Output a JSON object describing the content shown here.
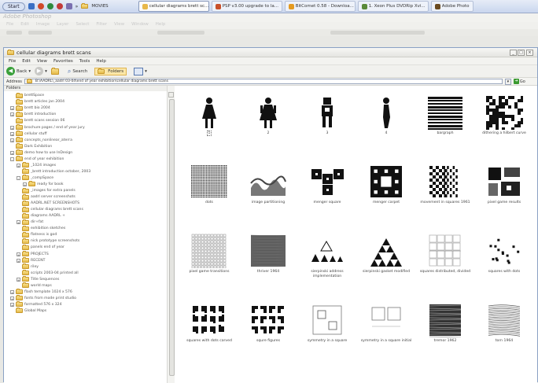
{
  "taskbar": {
    "start_label": "Start",
    "quick_label": "MOVIES",
    "buttons": [
      {
        "label": "cellular diagrams brett sc...",
        "icon": "folder-icon",
        "color": "#e8b84a",
        "active": true
      },
      {
        "label": "PSP v3.00 upgrade to la...",
        "icon": "browser-icon",
        "color": "#c8502a",
        "active": false
      },
      {
        "label": "BitComet 0.58 - Downloa...",
        "icon": "bitcomet-icon",
        "color": "#e49a20",
        "active": false
      },
      {
        "label": "1. Xeon Plus DVDRip Xvi...",
        "icon": "media-icon",
        "color": "#5a8a3a",
        "active": false
      },
      {
        "label": "Adobe Photo",
        "icon": "photoshop-icon",
        "color": "#6a4a20",
        "active": false
      }
    ]
  },
  "photoshop": {
    "title": "Adobe Photoshop",
    "menu": [
      "File",
      "Edit",
      "Image",
      "Layer",
      "Select",
      "Filter",
      "View",
      "Window",
      "Help"
    ]
  },
  "window": {
    "title": "cellular diagrams brett scans",
    "menu": [
      "File",
      "Edit",
      "View",
      "Favorites",
      "Tools",
      "Help"
    ],
    "toolbar": {
      "back": "Back",
      "search": "Search",
      "folders": "Folders"
    },
    "address_label": "Address",
    "address_value": "B:\\AADRL\\_aadrl 03-04\\end of year exhibition\\cellular diagrams brett scans",
    "go_label": "Go",
    "folders_pane_title": "Folders",
    "folders_close": "×"
  },
  "tree": [
    {
      "label": "brettSpace",
      "level": 0,
      "exp": ""
    },
    {
      "label": "brett articles jan 2004",
      "level": 0,
      "exp": ""
    },
    {
      "label": "brett bio 2004",
      "level": 0,
      "exp": "+"
    },
    {
      "label": "brett introduction",
      "level": 0,
      "exp": "+"
    },
    {
      "label": "brett scans session 06",
      "level": 0,
      "exp": ""
    },
    {
      "label": "brochure pages / end of year jury",
      "level": 0,
      "exp": "+"
    },
    {
      "label": "cellular stuff",
      "level": 0,
      "exp": "+"
    },
    {
      "label": "concepts_nonlinear_aterra",
      "level": 0,
      "exp": "+"
    },
    {
      "label": "Dark Exhibition",
      "level": 0,
      "exp": ""
    },
    {
      "label": "demo how to use InDesign",
      "level": 0,
      "exp": "+"
    },
    {
      "label": "end of year exhibition",
      "level": 0,
      "exp": "-"
    },
    {
      "label": "_1024 images",
      "level": 1,
      "exp": "+"
    },
    {
      "label": "_brett introduction october, 2003",
      "level": 1,
      "exp": ""
    },
    {
      "label": "_compSpace",
      "level": 1,
      "exp": "-"
    },
    {
      "label": "ready for book",
      "level": 2,
      "exp": "+"
    },
    {
      "label": "_images for extra panels",
      "level": 1,
      "exp": ""
    },
    {
      "label": "aadrl server screenshots",
      "level": 1,
      "exp": ""
    },
    {
      "label": "AADRL.NET SCREENSHOTS",
      "level": 1,
      "exp": ""
    },
    {
      "label": "cellular diagrams brett scans",
      "level": 1,
      "exp": ""
    },
    {
      "label": "diagrams AADRL +",
      "level": 1,
      "exp": ""
    },
    {
      "label": "dir+fat",
      "level": 1,
      "exp": "+"
    },
    {
      "label": "exhibition sketches",
      "level": 1,
      "exp": ""
    },
    {
      "label": "flatness is god",
      "level": 1,
      "exp": ""
    },
    {
      "label": "nick prototype screenshots",
      "level": 1,
      "exp": ""
    },
    {
      "label": "panels end of year",
      "level": 1,
      "exp": ""
    },
    {
      "label": "PROJECTS",
      "level": 1,
      "exp": "+"
    },
    {
      "label": "RECENT",
      "level": 1,
      "exp": "+"
    },
    {
      "label": "riley",
      "level": 1,
      "exp": ""
    },
    {
      "label": "scripts 2003-04 printed all",
      "level": 1,
      "exp": ""
    },
    {
      "label": "Title Sequences",
      "level": 1,
      "exp": "+"
    },
    {
      "label": "world maps",
      "level": 1,
      "exp": ""
    },
    {
      "label": "flash template 1024 x 576",
      "level": 0,
      "exp": "+"
    },
    {
      "label": "fonts from mode print studio",
      "level": 0,
      "exp": "+"
    },
    {
      "label": "formatted 576 x 324",
      "level": 0,
      "exp": "+"
    },
    {
      "label": "Global Maps",
      "level": 0,
      "exp": ""
    }
  ],
  "files": [
    {
      "label": "1",
      "thumb": "figure-woman"
    },
    {
      "label": "2",
      "thumb": "figure-dress"
    },
    {
      "label": "3",
      "thumb": "figure-robot"
    },
    {
      "label": "4",
      "thumb": "figure-side"
    },
    {
      "label": "bargraph",
      "thumb": "bargraph"
    },
    {
      "label": "dithering a hilbert curve",
      "thumb": "hilbert"
    },
    {
      "label": "dots",
      "thumb": "dots"
    },
    {
      "label": "image partitioning",
      "thumb": "partition"
    },
    {
      "label": "menger square",
      "thumb": "menger-cube"
    },
    {
      "label": "menger carpet",
      "thumb": "menger-carpet"
    },
    {
      "label": "movement in squares 1961",
      "thumb": "checker"
    },
    {
      "label": "pixel game results",
      "thumb": "pixel-game"
    },
    {
      "label": "pixel game transitions",
      "thumb": "pixel-grid"
    },
    {
      "label": "thriver 1964",
      "thumb": "thriver"
    },
    {
      "label": "sierpinski address implementation",
      "thumb": "sierpinski-row"
    },
    {
      "label": "sierpinski gasket modified",
      "thumb": "sierpinski"
    },
    {
      "label": "squares distributed, divided",
      "thumb": "squares-divided"
    },
    {
      "label": "squares with dots",
      "thumb": "squares-dots"
    },
    {
      "label": "squares with dots carved",
      "thumb": "carved"
    },
    {
      "label": "squre figures",
      "thumb": "squre-figures"
    },
    {
      "label": "symmetry in a square",
      "thumb": "symmetry"
    },
    {
      "label": "symmetry in a square initial",
      "thumb": "symmetry-initial"
    },
    {
      "label": "tremor 1962",
      "thumb": "tremor"
    },
    {
      "label": "torn 1964",
      "thumb": "torn"
    }
  ]
}
